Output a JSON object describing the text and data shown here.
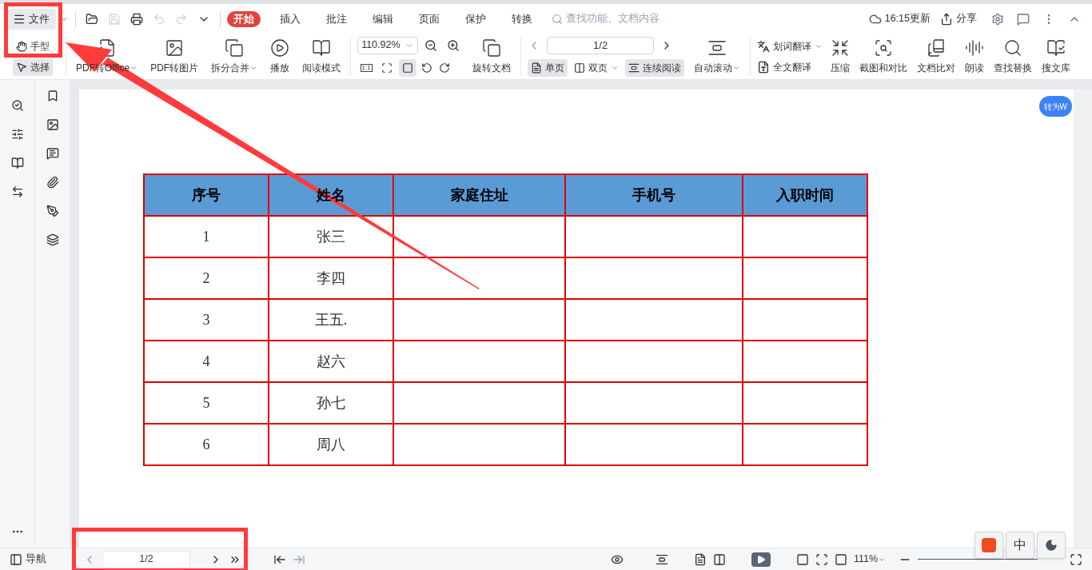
{
  "menu_button": {
    "label": "文件"
  },
  "menu_tabs": [
    {
      "label": "开始",
      "selected": true
    },
    {
      "label": "插入",
      "selected": false
    },
    {
      "label": "批注",
      "selected": false
    },
    {
      "label": "编辑",
      "selected": false
    },
    {
      "label": "页面",
      "selected": false
    },
    {
      "label": "保护",
      "selected": false
    },
    {
      "label": "转换",
      "selected": false
    }
  ],
  "search": {
    "placeholder": "查找功能、文档内容"
  },
  "sync_status": "16:15更新",
  "share": "分享",
  "cursor_tools": [
    {
      "label": "手型",
      "selected": false
    },
    {
      "label": "选择",
      "selected": true
    }
  ],
  "tools_a": [
    {
      "label": "PDF转Office",
      "dropdown": true
    },
    {
      "label": "PDF转图片",
      "dropdown": false
    },
    {
      "label": "拆分合并",
      "dropdown": true
    },
    {
      "label": "播放",
      "dropdown": false
    },
    {
      "label": "阅读模式",
      "dropdown": false
    }
  ],
  "zoom": {
    "value": "110.92%"
  },
  "fit_modes": [
    {
      "kind": "actual",
      "label": "1:1",
      "selected": false
    },
    {
      "kind": "page",
      "selected": false
    },
    {
      "kind": "width",
      "selected": true
    }
  ],
  "rotate": "旋转文档",
  "page_field": "1/2",
  "view_modes": [
    {
      "label": "单页",
      "selected": true,
      "dropdown": false
    },
    {
      "label": "双页",
      "selected": false,
      "dropdown": true
    },
    {
      "label": "连续阅读",
      "selected": true,
      "dropdown": false
    }
  ],
  "auto_scroll": "自动滚动",
  "translate": [
    {
      "label": "划词翻译",
      "dropdown": true
    },
    {
      "label": "全文翻译",
      "dropdown": false
    }
  ],
  "tools_b": [
    "压缩",
    "截图和对比",
    "文档比对",
    "朗读",
    "查找替换",
    "搜文库"
  ],
  "side_badge": "转为W",
  "table": {
    "columns": [
      "序号",
      "姓名",
      "家庭住址",
      "手机号",
      "入职时间"
    ],
    "rows": [
      [
        "1",
        "张三"
      ],
      [
        "2",
        "李四"
      ],
      [
        "3",
        "王五."
      ],
      [
        "4",
        "赵六"
      ],
      [
        "5",
        "孙七"
      ],
      [
        "6",
        "周八"
      ]
    ]
  },
  "status_bar": {
    "nav": "导航",
    "page": "1/2",
    "zoom": "111%"
  },
  "ime": {
    "label": "中"
  }
}
